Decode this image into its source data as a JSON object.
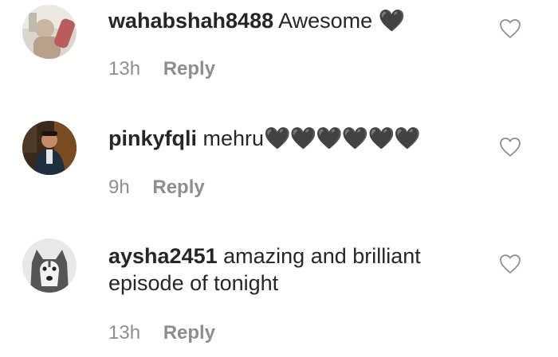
{
  "comments": [
    {
      "username": "wahabshah8488",
      "text": "Awesome",
      "emoji": "🖤",
      "time": "13h",
      "reply_label": "Reply",
      "avatar_icon": "user-avatar-light-photo"
    },
    {
      "username": "pinkyfqli",
      "text": "mehru",
      "emoji": "🖤🖤🖤🖤🖤🖤",
      "time": "9h",
      "reply_label": "Reply",
      "avatar_icon": "user-avatar-dark-photo"
    },
    {
      "username": "aysha2451",
      "text": "amazing and brilliant episode of tonight",
      "emoji": "",
      "time": "13h",
      "reply_label": "Reply",
      "avatar_icon": "user-avatar-husky-photo"
    }
  ],
  "like_icon": "heart-outline-icon",
  "colors": {
    "text": "#262626",
    "meta": "#8e8e8e",
    "background": "#ffffff"
  }
}
